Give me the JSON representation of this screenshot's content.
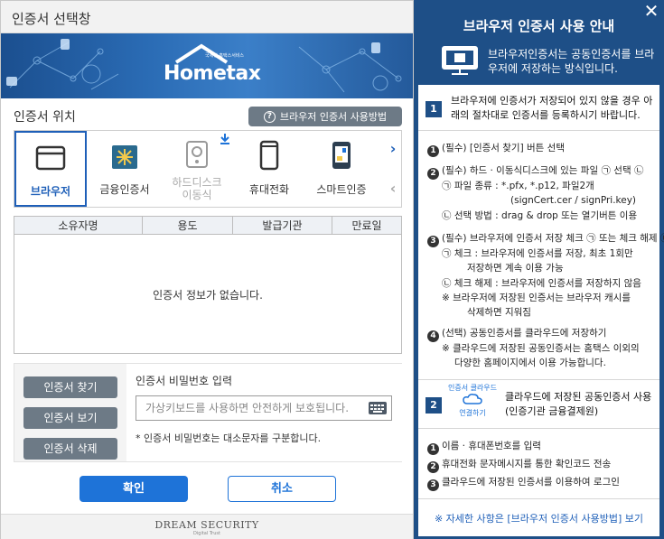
{
  "dialog": {
    "title": "인증서 선택창",
    "logo": "Hometax",
    "logo_sub": "국세청 홈택스서비스",
    "location_label": "인증서 위치",
    "help_button": "브라우저 인증서 사용방법",
    "locations": [
      {
        "label": "브라우저",
        "icon": "browser-icon",
        "selected": true
      },
      {
        "label": "금융인증서",
        "icon": "financial-cert-icon",
        "selected": false
      },
      {
        "label": "하드디스크\n이동식",
        "icon": "hard-disk-icon",
        "selected": false,
        "disabled": true
      },
      {
        "label": "휴대전화",
        "icon": "mobile-phone-icon",
        "selected": false
      },
      {
        "label": "스마트인증",
        "icon": "smart-cert-icon",
        "selected": false
      }
    ],
    "table": {
      "columns": [
        "소유자명",
        "용도",
        "발급기관",
        "만료일"
      ],
      "empty_message": "인증서 정보가 없습니다."
    },
    "buttons": {
      "find": "인증서 찾기",
      "view": "인증서 보기",
      "delete": "인증서 삭제",
      "ok": "확인",
      "cancel": "취소"
    },
    "password": {
      "label": "인증서 비밀번호 입력",
      "placeholder": "가상키보드를 사용하면 안전하게 보호됩니다.",
      "value": "",
      "note": "* 인증서 비밀번호는 대소문자를 구분합니다."
    },
    "footer": {
      "brand": "DREAM SECURITY",
      "sub": "Digital Trust"
    }
  },
  "guide": {
    "title": "브라우저 인증서 사용 안내",
    "intro": "브라우저인증서는 공동인증서를 브라우저에 저장하는 방식입니다.",
    "section1": {
      "num": "1",
      "header": "브라우저에 인증서가 저장되어 있지 않을 경우 아래의 절차대로 인증서를 등록하시기 바랍니다.",
      "lines": [
        "(필수) [인증서 찾기] 버튼 선택",
        "(필수) 하드 · 이동식디스크에 있는 파일 ㉠ 선택 ㉡",
        "㉠ 파일 종류 : *.pfx, *.p12, 파일2개",
        "(signCert.cer / signPri.key)",
        "㉡ 선택 방법 : drag & drop 또는 열기버튼 이용",
        "(필수) 브라우저에 인증서 저장 체크 ㉠ 또는 체크 해제 ㉡",
        "㉠ 체크 : 브라우저에 인증서를 저장, 최초 1회만",
        "저장하면 계속 이용 가능",
        "㉡ 체크 해제 : 브라우저에 인증서를 저장하지 않음",
        "※ 브라우저에 저장된 인증서는 브라우저 캐시를",
        "삭제하면 지워짐",
        "(선택) 공동인증서를 클라우드에 저장하기",
        "※ 클라우드에 저장된 공동인증서는 홈택스 이외의",
        "다양한 홈페이지에서 이용 가능합니다."
      ]
    },
    "section2": {
      "num": "2",
      "cloud_top": "인증서 클라우드",
      "cloud_bottom": "연결하기",
      "header": "클라우드에 저장된 공동인증서 사용 (인증기관 금융결제원)",
      "lines": [
        "이름 · 휴대폰번호를 입력",
        "휴대전화 문자메시지를 통한 확인코드 전송",
        "클라우드에 저장된 인증서를 이용하여 로그인"
      ]
    },
    "more_link": "※ 자세한 사항은 [브라우저 인증서 사용방법] 보기"
  }
}
